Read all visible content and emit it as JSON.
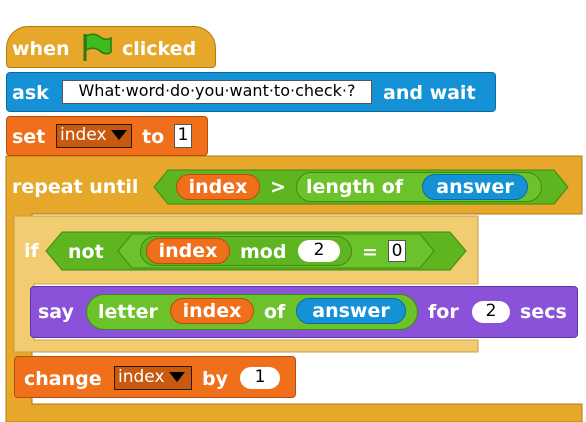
{
  "colors": {
    "control": "#e6a72a",
    "control_light": "#f2cc70",
    "sensing": "#1592d6",
    "variables": "#ef6f1a",
    "operators": "#5fb520",
    "looks": "#8a51d9"
  },
  "hat": {
    "when": "when",
    "flag_icon": "green-flag-icon",
    "clicked": "clicked"
  },
  "ask": {
    "label": "ask",
    "question": "What·word·do·you·want·to·check·?",
    "and_wait": "and wait"
  },
  "set": {
    "label": "set",
    "variable": "index",
    "to": "to",
    "value": "1"
  },
  "repeat": {
    "label": "repeat until",
    "var": "index",
    "op": ">",
    "length_of": "length of",
    "answer": "answer"
  },
  "if": {
    "label": "if",
    "not": "not",
    "var": "index",
    "mod": "mod",
    "mod_value": "2",
    "equals": "=",
    "compare_value": "0"
  },
  "say": {
    "label": "say",
    "letter": "letter",
    "var": "index",
    "of": "of",
    "answer": "answer",
    "for": "for",
    "secs_value": "2",
    "secs": "secs"
  },
  "change": {
    "label": "change",
    "variable": "index",
    "by": "by",
    "value": "1"
  }
}
